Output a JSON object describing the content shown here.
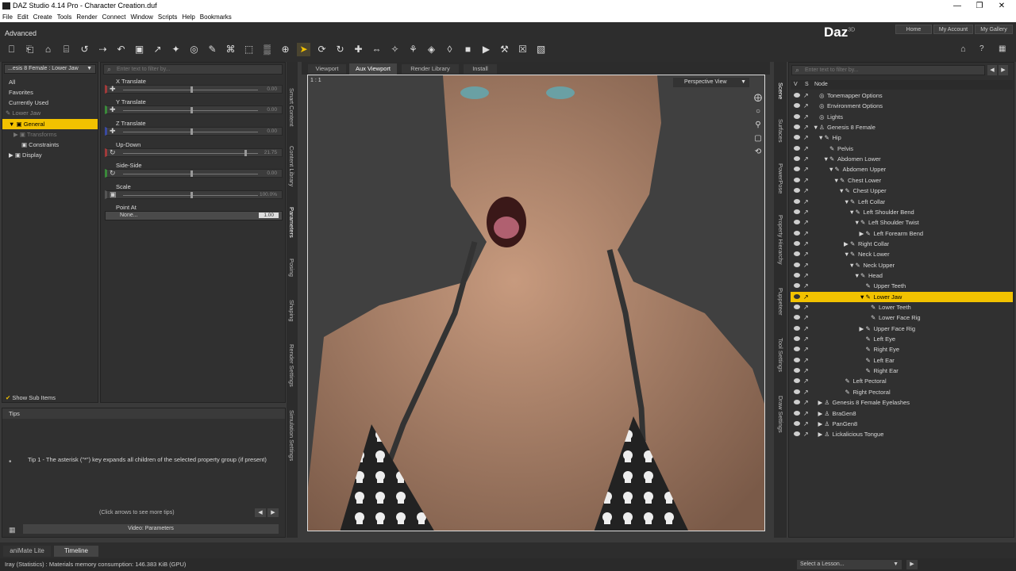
{
  "window": {
    "title": "DAZ Studio 4.14 Pro - Character Creation.duf",
    "minimize": "—",
    "maximize": "❐",
    "close": "✕"
  },
  "menu": [
    "File",
    "Edit",
    "Create",
    "Tools",
    "Render",
    "Connect",
    "Window",
    "Scripts",
    "Help",
    "Bookmarks"
  ],
  "header": {
    "layout": "Advanced",
    "logo": "Daz",
    "logo_sup": "3D",
    "buttons": [
      "Home",
      "My Account",
      "My Gallery"
    ]
  },
  "toolbar": [
    "⎕",
    "⎗",
    "⌂",
    "⌸",
    "↺",
    "⇢",
    "↶",
    "▣",
    "↗",
    "✦",
    "◎",
    "✎",
    "⌘",
    "⬚",
    "▒",
    "⊕",
    "➤",
    "⟳",
    "↻",
    "✚",
    "⇔",
    "✧",
    "⚘",
    "◈",
    "◊",
    "■",
    "▶",
    "⚒",
    "☒",
    "▧"
  ],
  "left": {
    "node_dropdown": "...esis 8 Female : Lower Jaw",
    "groups": [
      "All",
      "Favorites",
      "Currently Used"
    ],
    "tree": [
      "Lower Jaw",
      "General",
      "Transforms",
      "Constraints",
      "Display"
    ],
    "show_sub": "Show Sub Items",
    "filter_placeholder": "Enter text to filter by..."
  },
  "params": [
    {
      "name": "X Translate",
      "value": "0.00",
      "color": "#a03a3a",
      "level": 0.5
    },
    {
      "name": "Y Translate",
      "value": "0.00",
      "color": "#3a8a3a",
      "level": 0.5
    },
    {
      "name": "Z Translate",
      "value": "0.00",
      "color": "#3a4aa0",
      "level": 0.5
    },
    {
      "name": "Up-Down",
      "value": "21.75",
      "color": "#a03a3a",
      "level": 0.9
    },
    {
      "name": "Side-Side",
      "value": "0.00",
      "color": "#3a8a3a",
      "level": 0.5
    },
    {
      "name": "Scale",
      "value": "100.0%",
      "color": "#555555",
      "level": 0.5
    }
  ],
  "pointat": {
    "name": "Point At",
    "value": "None...",
    "num": "1.00"
  },
  "side_tabs_mid": [
    "Smart Content",
    "Content Library",
    "Parameters",
    "Posing",
    "Shaping",
    "Render Settings",
    "Simulation Settings"
  ],
  "tips": {
    "title": "Tips",
    "text": "Tip 1 - The asterisk (\"*\") key expands all children of the selected property group (if present)",
    "nav": "(Click arrows to see more tips)",
    "video": "Video: Parameters"
  },
  "viewport": {
    "tabs": [
      "Viewport",
      "Aux Viewport",
      "Render Library",
      "Install"
    ],
    "ratio": "1 : 1",
    "view": "Perspective View"
  },
  "scene": {
    "filter_placeholder": "Enter text to filter by...",
    "cols": [
      "V",
      "S",
      "Node"
    ],
    "nodes": [
      "Tonemapper Options",
      "Environment Options",
      "Lights",
      "Genesis 8 Female",
      "Hip",
      "Pelvis",
      "Abdomen Lower",
      "Abdomen Upper",
      "Chest Lower",
      "Chest Upper",
      "Left Collar",
      "Left Shoulder Bend",
      "Left Shoulder Twist",
      "Left Forearm Bend",
      "Right Collar",
      "Neck Lower",
      "Neck Upper",
      "Head",
      "Upper Teeth",
      "Lower Jaw",
      "Lower Teeth",
      "Lower Face Rig",
      "Upper Face Rig",
      "Left Eye",
      "Right Eye",
      "Left Ear",
      "Right Ear",
      "Left Pectoral",
      "Right Pectoral",
      "Genesis 8 Female Eyelashes",
      "BraGen8",
      "PanGen8",
      "Lickalicious Tongue"
    ],
    "indent": [
      0,
      0,
      0,
      0,
      1,
      2,
      2,
      3,
      4,
      5,
      6,
      7,
      8,
      9,
      6,
      6,
      7,
      8,
      9,
      9,
      10,
      10,
      9,
      9,
      9,
      9,
      9,
      5,
      5,
      1,
      1,
      1,
      1
    ]
  },
  "side_tabs_right": [
    "Scene",
    "Surfaces",
    "PowerPose",
    "Property Hierarchy",
    "Puppeteer",
    "Tool Settings",
    "Draw Settings"
  ],
  "bottom": {
    "tabs": [
      "aniMate Lite",
      "Timeline"
    ],
    "status": "Iray (Statistics) : Materials memory consumption: 146.383 KiB (GPU)",
    "lesson": "Select a Lesson..."
  },
  "colors": {
    "accent": "#f2c200",
    "panel": "#303030"
  }
}
